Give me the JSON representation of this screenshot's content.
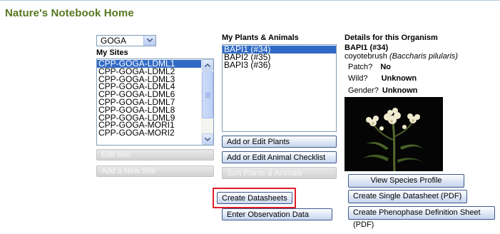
{
  "page": {
    "title": "Nature's Notebook Home"
  },
  "sites": {
    "group_select": {
      "value": "GOGA"
    },
    "heading": "My Sites",
    "items": [
      {
        "label": "CPP-GOGA-LDML1",
        "selected": true
      },
      {
        "label": "CPP-GOGA-LDML2",
        "selected": false
      },
      {
        "label": "CPP-GOGA-LDML3",
        "selected": false
      },
      {
        "label": "CPP-GOGA-LDML4",
        "selected": false
      },
      {
        "label": "CPP-GOGA-LDML6",
        "selected": false
      },
      {
        "label": "CPP-GOGA-LDML7",
        "selected": false
      },
      {
        "label": "CPP-GOGA-LDML8",
        "selected": false
      },
      {
        "label": "CPP-GOGA-LDML9",
        "selected": false
      },
      {
        "label": "CPP-GOGA-MORI1",
        "selected": false
      },
      {
        "label": "CPP-GOGA-MORI2",
        "selected": false
      }
    ],
    "edit_site_label": "Edit Site",
    "add_site_label": "Add a New Site"
  },
  "plants": {
    "heading": "My Plants & Animals",
    "items": [
      {
        "label": "BAPI1 (#34)",
        "selected": true
      },
      {
        "label": "BAPI2 (#35)",
        "selected": false
      },
      {
        "label": "BAPI3 (#36)",
        "selected": false
      }
    ],
    "add_edit_plants_label": "Add or Edit Plants",
    "add_edit_animal_label": "Add or Edit Animal Checklist",
    "sort_label": "Sort Plants & Animals",
    "create_datasheets_label": "Create Datasheets",
    "enter_observation_label": "Enter Observation Data"
  },
  "details": {
    "heading": "Details for this Organism",
    "organism_id": "BAPI1 (#34)",
    "common_name": "coyotebrush",
    "scientific_name": "(Baccharis pilularis)",
    "patch_label": "Patch?",
    "patch_value": "No",
    "wild_label": "Wild?",
    "wild_value": "Unknown",
    "gender_label": "Gender?",
    "gender_value": "Unknown",
    "view_profile_label": "View Species Profile",
    "single_datasheet_label": "Create Single Datasheet (PDF)",
    "phenophase_sheet_label": "Create Phenophase Definition Sheet (PDF)"
  },
  "colors": {
    "title_green": "#56771f",
    "selection_blue": "#316ac5",
    "highlight_red": "#dd1e2a"
  }
}
